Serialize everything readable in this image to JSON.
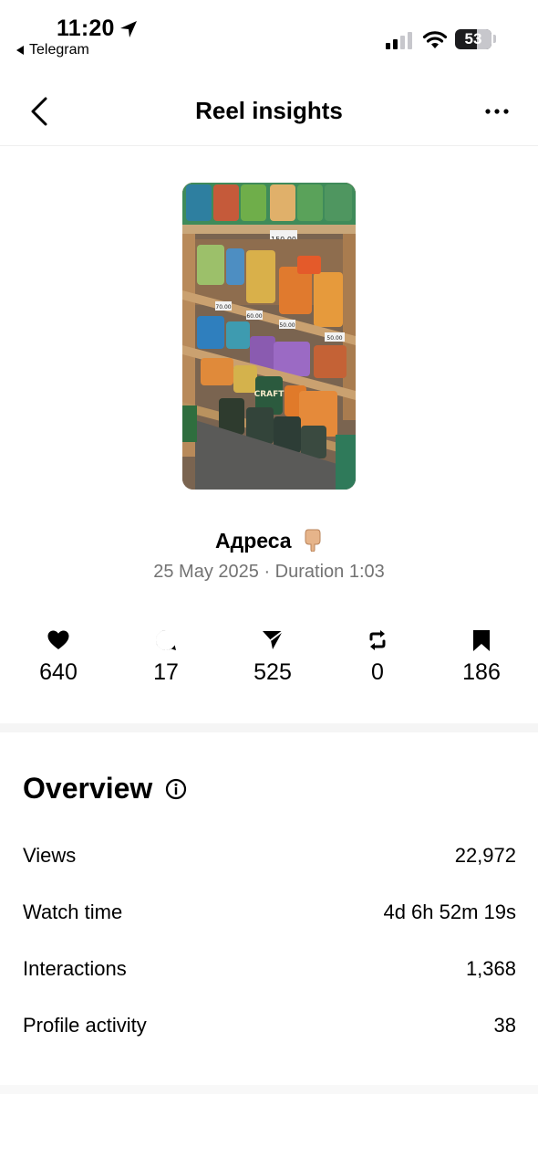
{
  "status_bar": {
    "time": "11:20",
    "back_app": "Telegram",
    "battery": "53"
  },
  "nav": {
    "title": "Reel insights"
  },
  "reel": {
    "caption": "Адреса",
    "date": "25 May 2025",
    "separator": "·",
    "duration_label": "Duration 1:03",
    "thumbnail_price_tags": [
      "150.00",
      "70.00",
      "60.00",
      "50.00",
      "50.00"
    ],
    "thumbnail_label": "CRAFT"
  },
  "stats": {
    "likes": "640",
    "comments": "17",
    "shares": "525",
    "reposts": "0",
    "saves": "186"
  },
  "overview": {
    "title": "Overview",
    "rows": [
      {
        "label": "Views",
        "value": "22,972"
      },
      {
        "label": "Watch time",
        "value": "4d 6h 52m 19s"
      },
      {
        "label": "Interactions",
        "value": "1,368"
      },
      {
        "label": "Profile activity",
        "value": "38"
      }
    ]
  },
  "colors": {
    "muted_text": "#737373",
    "band": "#f5f5f5"
  }
}
